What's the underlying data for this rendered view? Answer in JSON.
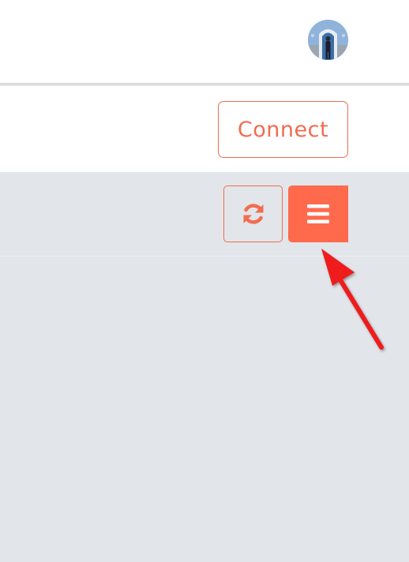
{
  "header": {
    "avatar_icon": "user-avatar-photo"
  },
  "connect": {
    "label": "Connect"
  },
  "toolbar": {
    "refresh_icon": "refresh-icon",
    "menu_icon": "hamburger-menu-icon"
  },
  "colors": {
    "accent": "#f26c4f",
    "menu_button_bg": "#ff6a4d",
    "page_bg": "#e2e5ea",
    "annotation_arrow": "#ee1c1c"
  }
}
